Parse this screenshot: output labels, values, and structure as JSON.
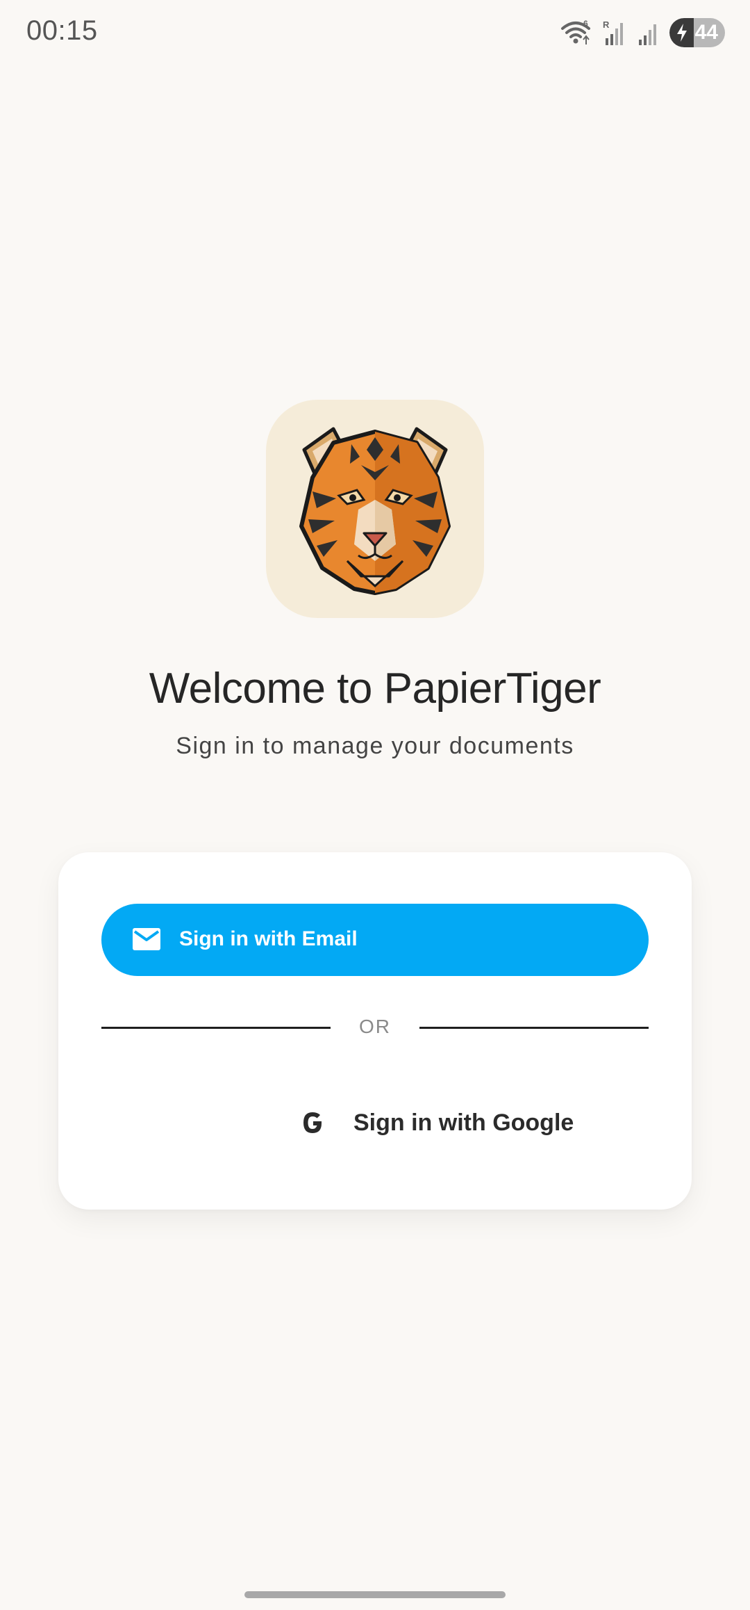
{
  "status_bar": {
    "time": "00:15",
    "battery_level": "44",
    "icons": [
      "wifi-icon",
      "signal-roaming-icon",
      "signal-icon",
      "battery-charging-icon"
    ]
  },
  "logo": {
    "icon": "tiger-head-icon",
    "background_color": "#f5ecd9"
  },
  "welcome": {
    "title": "Welcome to PapierTiger",
    "subtitle": "Sign in to manage your documents"
  },
  "signin_card": {
    "email_button_label": "Sign in with Email",
    "email_icon": "mail-icon",
    "divider_text": "OR",
    "google_button_label": "Sign in with Google",
    "google_icon": "google-icon"
  },
  "colors": {
    "primary": "#03a9f4",
    "background": "#faf8f5",
    "card": "#ffffff"
  }
}
